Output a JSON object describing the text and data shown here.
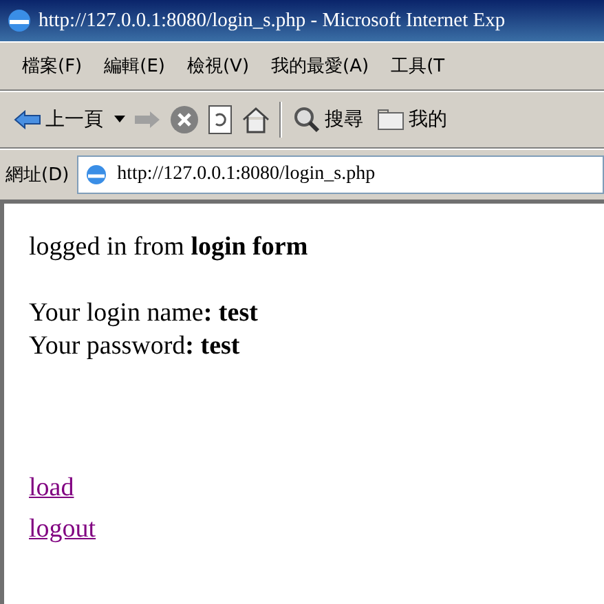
{
  "window": {
    "title": "http://127.0.0.1:8080/login_s.php - Microsoft Internet Exp"
  },
  "menu": [
    "檔案(F)",
    "編輯(E)",
    "檢視(V)",
    "我的最愛(A)",
    "工具(T"
  ],
  "toolbar": {
    "back": "上一頁",
    "search": "搜尋",
    "favorites": "我的"
  },
  "address": {
    "label": "網址(D)",
    "value": "http://127.0.0.1:8080/login_s.php"
  },
  "page": {
    "heading": "logged in from **login form**",
    "lines": [
      "Your login name**: test**",
      "Your password**: test**"
    ],
    "links": [
      {
        "text": "load",
        "visited": true
      },
      {
        "text": "logout",
        "visited": true
      }
    ]
  }
}
